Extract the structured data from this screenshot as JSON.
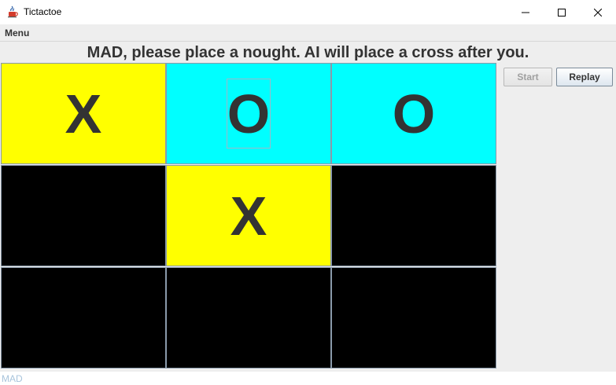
{
  "window": {
    "title": "Tictactoe",
    "icon": "java-cup-icon"
  },
  "menubar": {
    "menu_label": "Menu"
  },
  "status": {
    "message": "MAD, please place a nought. AI will place a cross after you."
  },
  "board": {
    "cells": [
      {
        "mark": "X",
        "color": "#ffff00"
      },
      {
        "mark": "O",
        "color": "#00ffff"
      },
      {
        "mark": "O",
        "color": "#00ffff"
      },
      {
        "mark": "",
        "color": "#000000"
      },
      {
        "mark": "X",
        "color": "#ffff00"
      },
      {
        "mark": "",
        "color": "#000000"
      },
      {
        "mark": "",
        "color": "#000000"
      },
      {
        "mark": "",
        "color": "#000000"
      },
      {
        "mark": "",
        "color": "#000000"
      }
    ]
  },
  "controls": {
    "start_label": "Start",
    "replay_label": "Replay"
  },
  "footer": {
    "player_name": "MAD"
  }
}
